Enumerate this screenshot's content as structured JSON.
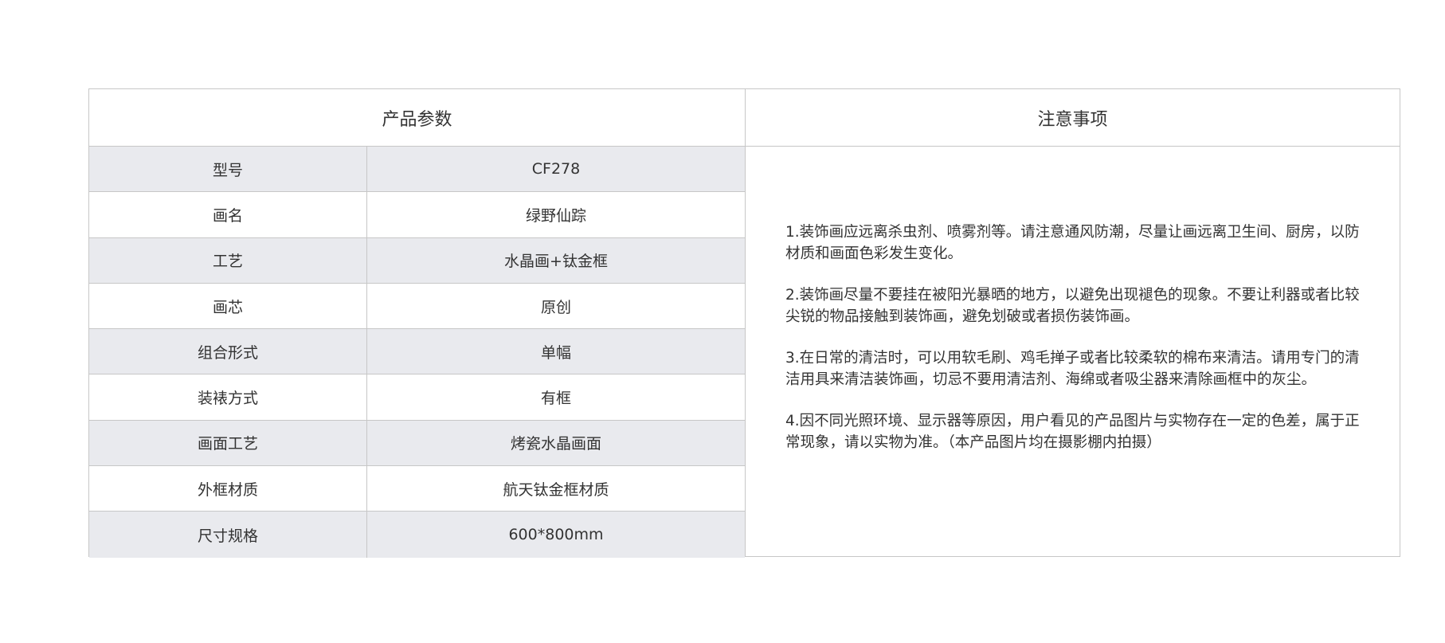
{
  "params": {
    "title": "产品参数",
    "rows": [
      {
        "key": "型号",
        "value": "CF278"
      },
      {
        "key": "画名",
        "value": "绿野仙踪"
      },
      {
        "key": "工艺",
        "value": "水晶画+钛金框"
      },
      {
        "key": "画芯",
        "value": "原创"
      },
      {
        "key": "组合形式",
        "value": "单幅"
      },
      {
        "key": "装裱方式",
        "value": "有框"
      },
      {
        "key": "画面工艺",
        "value": "烤瓷水晶画面"
      },
      {
        "key": "外框材质",
        "value": "航天钛金框材质"
      },
      {
        "key": "尺寸规格",
        "value": "600*800mm"
      }
    ]
  },
  "notes": {
    "title": "注意事项",
    "items": [
      "1.装饰画应远离杀虫剂、喷雾剂等。请注意通风防潮，尽量让画远离卫生间、厨房，以防材质和画面色彩发生变化。",
      "2.装饰画尽量不要挂在被阳光暴晒的地方，以避免出现褪色的现象。不要让利器或者比较尖锐的物品接触到装饰画，避免划破或者损伤装饰画。",
      "3.在日常的清洁时，可以用软毛刷、鸡毛掸子或者比较柔软的棉布来清洁。请用专门的清洁用具来清洁装饰画，切忌不要用清洁剂、海绵或者吸尘器来清除画框中的灰尘。",
      "4.因不同光照环境、显示器等原因，用户看见的产品图片与实物存在一定的色差，属于正常现象，请以实物为准。（本产品图片均在摄影棚内拍摄）"
    ]
  }
}
